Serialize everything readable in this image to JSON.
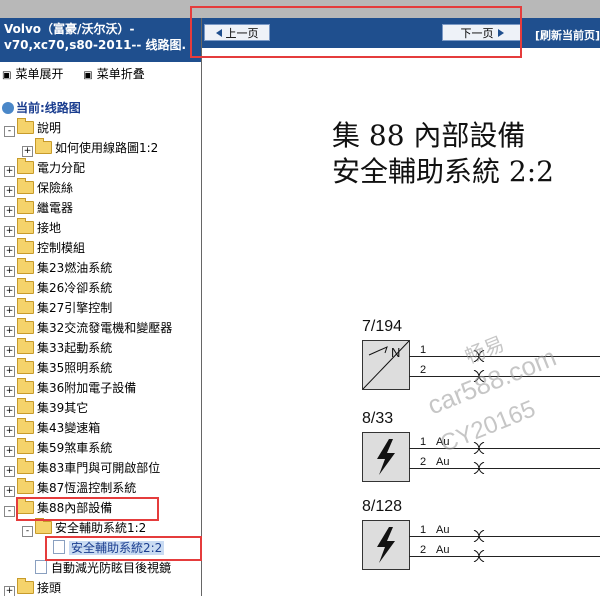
{
  "left_panel": {
    "title": "Volvo（富豪/沃尔沃）- v70,xc70,s80-2011-- 线路图.",
    "expand_label": "菜单展开",
    "collapse_label": "菜单折叠",
    "current_label": "当前:线路图"
  },
  "tree": [
    {
      "label": "說明",
      "indent": 0,
      "type": "folder",
      "toggle": "-"
    },
    {
      "label": "如何使用線路圖1:2",
      "indent": 1,
      "type": "folder",
      "toggle": "+"
    },
    {
      "label": "電力分配",
      "indent": 0,
      "type": "folder",
      "toggle": "+"
    },
    {
      "label": "保險絲",
      "indent": 0,
      "type": "folder",
      "toggle": "+"
    },
    {
      "label": "繼電器",
      "indent": 0,
      "type": "folder",
      "toggle": "+"
    },
    {
      "label": "接地",
      "indent": 0,
      "type": "folder",
      "toggle": "+"
    },
    {
      "label": "控制模組",
      "indent": 0,
      "type": "folder",
      "toggle": "+"
    },
    {
      "label": "集23燃油系統",
      "indent": 0,
      "type": "folder",
      "toggle": "+"
    },
    {
      "label": "集26冷卻系統",
      "indent": 0,
      "type": "folder",
      "toggle": "+"
    },
    {
      "label": "集27引擎控制",
      "indent": 0,
      "type": "folder",
      "toggle": "+"
    },
    {
      "label": "集32交流發電機和變壓器",
      "indent": 0,
      "type": "folder",
      "toggle": "+"
    },
    {
      "label": "集33起動系統",
      "indent": 0,
      "type": "folder",
      "toggle": "+"
    },
    {
      "label": "集35照明系統",
      "indent": 0,
      "type": "folder",
      "toggle": "+"
    },
    {
      "label": "集36附加電子設備",
      "indent": 0,
      "type": "folder",
      "toggle": "+"
    },
    {
      "label": "集39其它",
      "indent": 0,
      "type": "folder",
      "toggle": "+"
    },
    {
      "label": "集43變速箱",
      "indent": 0,
      "type": "folder",
      "toggle": "+"
    },
    {
      "label": "集59煞車系統",
      "indent": 0,
      "type": "folder",
      "toggle": "+"
    },
    {
      "label": "集83車門與可開啟部位",
      "indent": 0,
      "type": "folder",
      "toggle": "+"
    },
    {
      "label": "集87恆溫控制系統",
      "indent": 0,
      "type": "folder",
      "toggle": "+"
    },
    {
      "label": "集88內部設備",
      "indent": 0,
      "type": "folder",
      "toggle": "-"
    },
    {
      "label": "安全輔助系統1:2",
      "indent": 1,
      "type": "folder",
      "toggle": "-"
    },
    {
      "label": "安全輔助系統2:2",
      "indent": 2,
      "type": "doc",
      "toggle": "",
      "selected": true
    },
    {
      "label": "自動減光防眩目後視鏡",
      "indent": 1,
      "type": "doc",
      "toggle": ""
    },
    {
      "label": "接頭",
      "indent": 0,
      "type": "folder",
      "toggle": "+"
    }
  ],
  "nav": {
    "prev_label": "上一页",
    "next_label": "下一页",
    "refresh_label": "[刷新当前页]"
  },
  "document": {
    "title_line1": "集 88 內部設備",
    "title_line2": "安全輔助系統 2:2",
    "components": [
      {
        "code": "7/194",
        "pins": [
          "1",
          "2"
        ],
        "pin_labels": [
          "",
          ""
        ],
        "symbol": "sensor-N"
      },
      {
        "code": "8/33",
        "pins": [
          "1",
          "2"
        ],
        "pin_labels": [
          "Au",
          "Au"
        ],
        "symbol": "lightning"
      },
      {
        "code": "8/128",
        "pins": [
          "1",
          "2"
        ],
        "pin_labels": [
          "Au",
          "Au"
        ],
        "symbol": "lightning"
      }
    ],
    "watermark": [
      "畅易",
      "car588.com",
      "CY20165"
    ]
  },
  "colors": {
    "header_blue": "#1f4f8e",
    "highlight_red": "#e53c3c",
    "selected_bg": "#c9dbf2"
  }
}
